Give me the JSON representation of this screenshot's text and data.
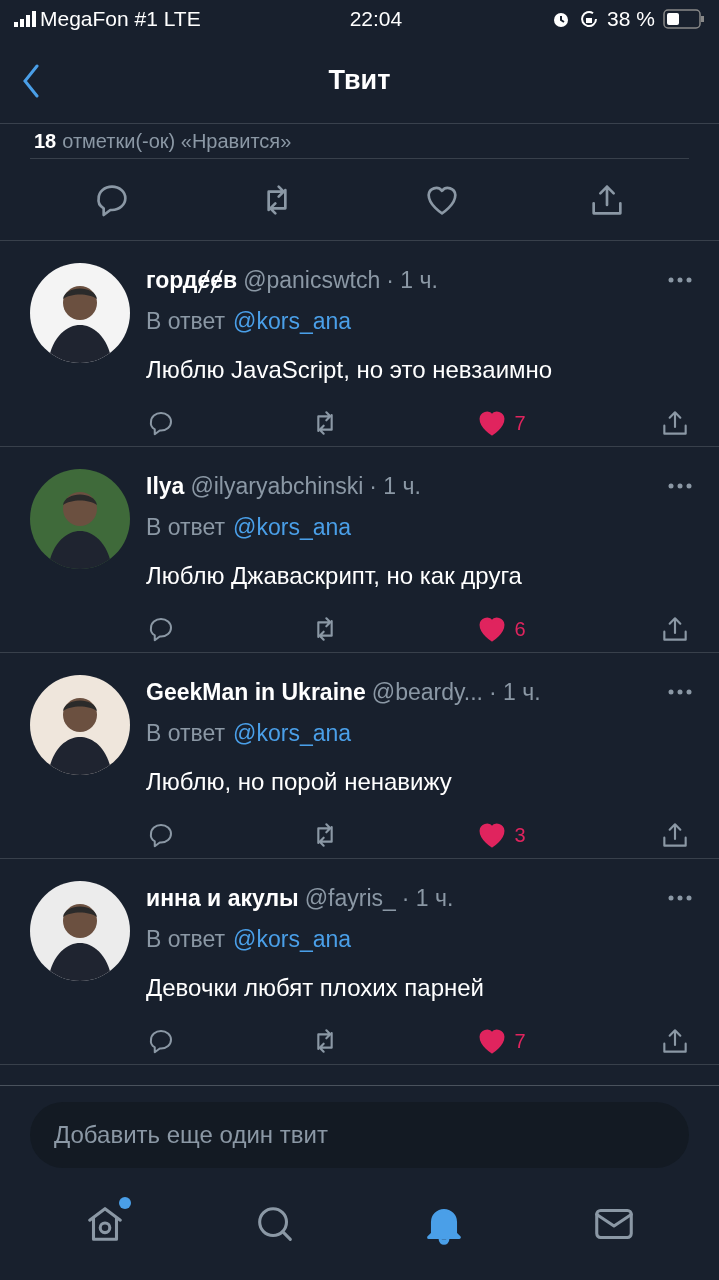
{
  "status_bar": {
    "carrier": "MegaFon #1 LTE",
    "time": "22:04",
    "battery": "38 %"
  },
  "header": {
    "title": "Твит"
  },
  "likes_summary": {
    "count": "18",
    "label": "отметки(-ок) «Нравится»"
  },
  "replies": [
    {
      "name": "гордɇɇв",
      "handle": "@panicswtch",
      "time": "· 1 ч.",
      "reply_prefix": "В ответ",
      "reply_to": "@kors_ana",
      "text": "Люблю JavaScript, но это невзаимно",
      "likes": "7",
      "liked": true
    },
    {
      "name": "Ilya",
      "handle": "@ilyaryabchinski",
      "time": "· 1 ч.",
      "reply_prefix": "В ответ",
      "reply_to": "@kors_ana",
      "text": "Люблю Джаваскрипт, но как друга",
      "likes": "6",
      "liked": true
    },
    {
      "name": "GeekMan in Ukraine",
      "handle": "@beardy...",
      "time": "· 1 ч.",
      "reply_prefix": "В ответ",
      "reply_to": "@kors_ana",
      "text": "Люблю, но порой ненавижу",
      "likes": "3",
      "liked": true
    },
    {
      "name": "инна и акулы",
      "handle": "@fayris_",
      "time": "· 1 ч.",
      "reply_prefix": "В ответ",
      "reply_to": "@kors_ana",
      "text": "Девочки любят плохих парней",
      "likes": "7",
      "liked": true
    }
  ],
  "composer": {
    "placeholder": "Добавить еще один твит"
  },
  "tabs": [
    {
      "kind": "home",
      "selected": false,
      "badge": true
    },
    {
      "kind": "search",
      "selected": false,
      "badge": false
    },
    {
      "kind": "notifications",
      "selected": true,
      "badge": false
    },
    {
      "kind": "messages",
      "selected": false,
      "badge": false
    }
  ]
}
